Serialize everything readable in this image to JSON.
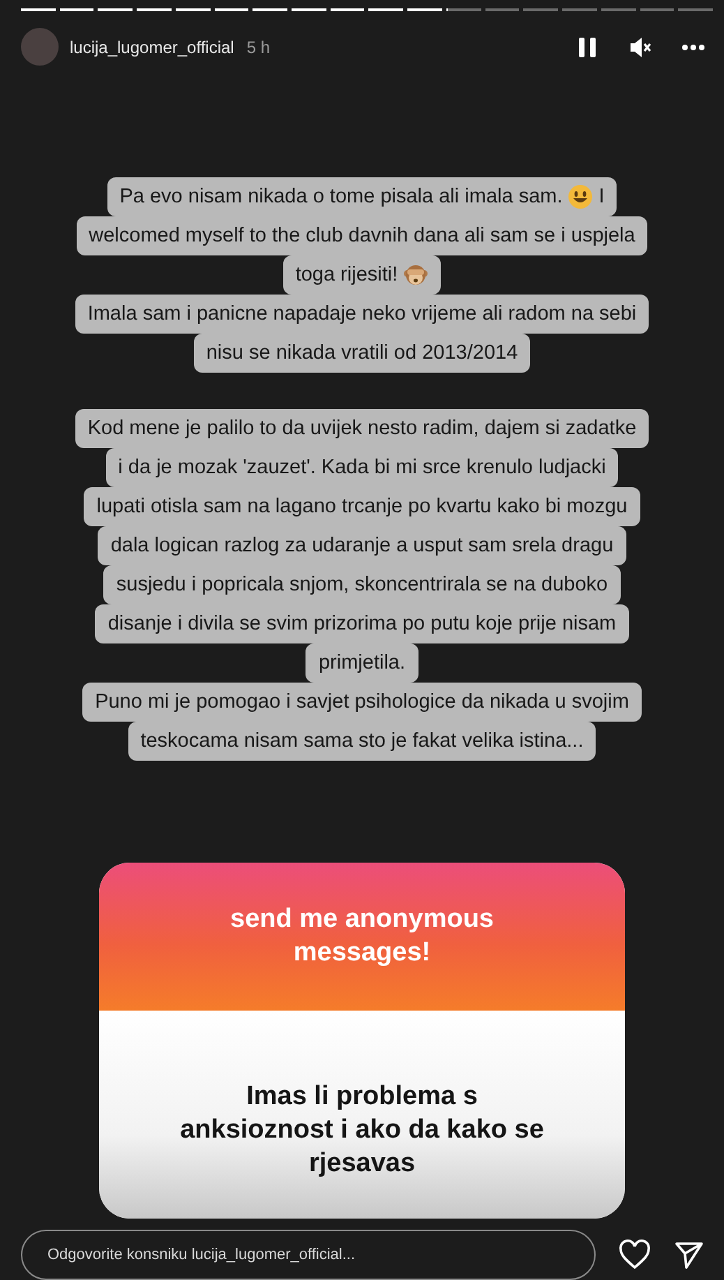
{
  "progress": [
    {
      "level": 1
    },
    {
      "level": 1
    },
    {
      "level": 1
    },
    {
      "level": 1
    },
    {
      "level": 1
    },
    {
      "level": 1
    },
    {
      "level": 1
    },
    {
      "level": 1
    },
    {
      "level": 1
    },
    {
      "level": 1
    },
    {
      "level": 1
    },
    {
      "level": 0.05
    },
    {
      "level": 0
    },
    {
      "level": 0
    },
    {
      "level": 0
    },
    {
      "level": 0
    },
    {
      "level": 0
    },
    {
      "level": 0
    }
  ],
  "header": {
    "username": "lucija_lugomer_official",
    "time": "5 h",
    "paused": true,
    "muted": true
  },
  "text_blocks": [
    {
      "lines": [
        [
          {
            "kind": "text",
            "text": "Pa evo nisam nikada o tome pisala ali imala sam."
          },
          {
            "kind": "smile"
          },
          {
            "kind": "text",
            "text": "I"
          }
        ],
        [
          {
            "kind": "text",
            "text": "welcomed myself to the club davnih dana ali sam se i uspjela"
          }
        ],
        [
          {
            "kind": "text",
            "text": "toga rijesiti!"
          },
          {
            "kind": "monkey"
          }
        ],
        [
          {
            "kind": "text",
            "text": "Imala sam i panicne napadaje neko vrijeme ali radom na sebi"
          }
        ],
        [
          {
            "kind": "text",
            "text": "nisu se nikada vratili od 2013/2014"
          }
        ]
      ]
    },
    {
      "lines": [
        [
          {
            "kind": "text",
            "text": "Kod mene je palilo to da uvijek nesto radim, dajem si zadatke"
          }
        ],
        [
          {
            "kind": "text",
            "text": "i da je mozak 'zauzet'.  Kada bi mi srce krenulo ludjacki"
          }
        ],
        [
          {
            "kind": "text",
            "text": "lupati otisla sam na lagano trcanje po kvartu kako bi mozgu"
          }
        ],
        [
          {
            "kind": "text",
            "text": "dala logican razlog za udaranje a usput sam srela dragu"
          }
        ],
        [
          {
            "kind": "text",
            "text": "susjedu i popricala snjom, skoncentrirala se na duboko"
          }
        ],
        [
          {
            "kind": "text",
            "text": "disanje i divila se svim prizorima po putu koje prije nisam"
          }
        ],
        [
          {
            "kind": "text",
            "text": "primjetila."
          }
        ],
        [
          {
            "kind": "text",
            "text": "Puno mi je pomogao i savjet psihologice da nikada u svojim"
          }
        ],
        [
          {
            "kind": "text",
            "text": "teskocama nisam sama sto je fakat velika istina..."
          }
        ]
      ]
    }
  ],
  "question_sticker": {
    "prompt": "send me anonymous messages!",
    "answer": "Imas li problema s anksioznost i ako da kako se rjesavas"
  },
  "reply": {
    "placeholder": "Odgovorite konsniku lucija_lugomer_official..."
  }
}
